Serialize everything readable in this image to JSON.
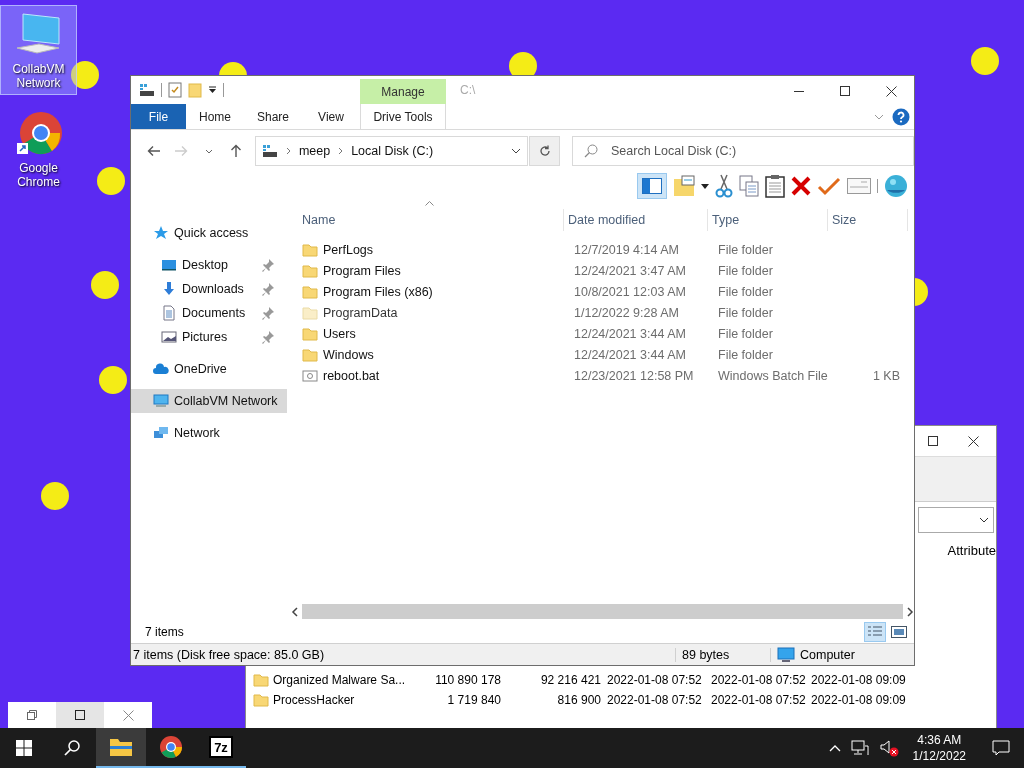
{
  "desktop_icons": [
    {
      "label": "CollabVM Network",
      "kind": "computer",
      "selected": true
    },
    {
      "label": "Google Chrome",
      "kind": "chrome",
      "selected": false
    }
  ],
  "archive_window": {
    "last_column_header": "Attribute",
    "rows": [
      {
        "name": "Organized Malware Sa...",
        "size": "110 890 178",
        "packed_size": "92 216 421",
        "modified": "2022-01-08 07:52",
        "created": "2022-01-08 07:52",
        "accessed": "2022-01-08 09:09"
      },
      {
        "name": "ProcessHacker",
        "size": "1 719 840",
        "packed_size": "816 900",
        "modified": "2022-01-08 07:52",
        "created": "2022-01-08 07:52",
        "accessed": "2022-01-08 09:09"
      }
    ]
  },
  "explorer": {
    "context_group": "Manage",
    "title_hint": "C:\\",
    "ribbon_tabs": [
      {
        "label": "File",
        "kind": "file",
        "selected": false
      },
      {
        "label": "Home",
        "kind": "plain",
        "selected": false
      },
      {
        "label": "Share",
        "kind": "plain",
        "selected": false
      },
      {
        "label": "View",
        "kind": "plain",
        "selected": false
      },
      {
        "label": "Drive Tools",
        "kind": "context",
        "selected": false
      }
    ],
    "breadcrumbs": [
      "meep",
      "Local Disk (C:)"
    ],
    "search": {
      "placeholder": "Search Local Disk (C:)"
    },
    "navigation": [
      {
        "label": "Quick access",
        "kind": "star",
        "selected": false,
        "children": [
          {
            "label": "Desktop",
            "kind": "desktop",
            "pinned": true,
            "selected": false
          },
          {
            "label": "Downloads",
            "kind": "download",
            "pinned": true,
            "selected": false
          },
          {
            "label": "Documents",
            "kind": "document",
            "pinned": true,
            "selected": false
          },
          {
            "label": "Pictures",
            "kind": "picture",
            "pinned": true,
            "selected": false
          }
        ]
      },
      {
        "label": "OneDrive",
        "kind": "cloud",
        "selected": false
      },
      {
        "label": "CollabVM Network",
        "kind": "computer",
        "selected": true
      },
      {
        "label": "Network",
        "kind": "network",
        "selected": false
      }
    ],
    "columns": [
      "Name",
      "Date modified",
      "Type",
      "Size"
    ],
    "files": [
      {
        "name": "PerfLogs",
        "kind": "folder",
        "hidden": false,
        "date_modified": "12/7/2019 4:14 AM",
        "type": "File folder"
      },
      {
        "name": "Program Files",
        "kind": "folder",
        "hidden": false,
        "date_modified": "12/24/2021 3:47 AM",
        "type": "File folder"
      },
      {
        "name": "Program Files (x86)",
        "kind": "folder",
        "hidden": false,
        "date_modified": "10/8/2021 12:03 AM",
        "type": "File folder"
      },
      {
        "name": "ProgramData",
        "kind": "folder",
        "hidden": true,
        "date_modified": "1/12/2022 9:28 AM",
        "type": "File folder"
      },
      {
        "name": "Users",
        "kind": "folder",
        "hidden": false,
        "date_modified": "12/24/2021 3:44 AM",
        "type": "File folder"
      },
      {
        "name": "Windows",
        "kind": "folder",
        "hidden": false,
        "date_modified": "12/24/2021 3:44 AM",
        "type": "File folder"
      },
      {
        "name": "reboot.bat",
        "kind": "batch",
        "hidden": false,
        "date_modified": "12/23/2021 12:58 PM",
        "type": "Windows Batch File",
        "size": "1 KB"
      }
    ],
    "item_count": "7 items",
    "views": [
      {
        "kind": "details",
        "selected": true
      },
      {
        "kind": "large",
        "selected": false
      }
    ],
    "status": {
      "summary": "7 items (Disk free space: 85.0 GB)",
      "size": "89 bytes",
      "zone": "Computer"
    }
  },
  "taskbar": {
    "apps": [
      {
        "kind": "explorer",
        "active": true
      },
      {
        "kind": "chrome",
        "active": false
      },
      {
        "kind": "archiver",
        "label": "7z",
        "active": false
      }
    ],
    "clock": {
      "time": "4:36 AM",
      "date": "1/12/2022"
    }
  }
}
